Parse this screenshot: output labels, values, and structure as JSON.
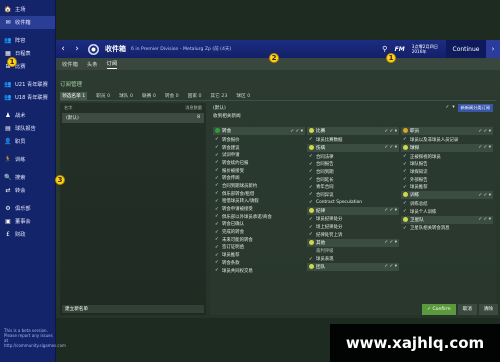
{
  "sidebar": {
    "items": [
      {
        "icon": "🏠",
        "label": "主场"
      },
      {
        "icon": "✉",
        "label": "收件箱"
      },
      {
        "icon": "👥",
        "label": "阵容"
      },
      {
        "icon": "▦",
        "label": "日程表"
      },
      {
        "icon": "⊞",
        "label": "比赛"
      },
      {
        "icon": "👥",
        "label": "U21 青年联赛"
      },
      {
        "icon": "👥",
        "label": "U18 青年联赛"
      },
      {
        "icon": "♟",
        "label": "战术"
      },
      {
        "icon": "▤",
        "label": "球队报告"
      },
      {
        "icon": "👤",
        "label": "职员"
      },
      {
        "icon": "🏃",
        "label": "训练"
      },
      {
        "icon": "🔍",
        "label": "搜索"
      },
      {
        "icon": "⇄",
        "label": "转会"
      },
      {
        "icon": "⚙",
        "label": "俱乐部"
      },
      {
        "icon": "▣",
        "label": "董事会"
      },
      {
        "icon": "£",
        "label": "财政"
      }
    ],
    "footer": "This is a beta version. Please report any issues at http://community.sigames.com"
  },
  "topbar": {
    "back": "‹",
    "forward": "›",
    "title": "收件箱",
    "subtitle": "6 in Premier Division - Metalurg Zp (前 (4天)",
    "search_icon": "⚲",
    "fm_logo": "FM",
    "date_line1": "3点零2月四日",
    "date_line2": "2016年",
    "continue_label": "Continue",
    "continue_arrow": "›"
  },
  "subtabs": [
    "收件箱",
    "头条",
    "订阅"
  ],
  "sub_header": "订阅管理",
  "filter_tabs": [
    "领选名单 1",
    "职员 0",
    "球队 0",
    "联赛 0",
    "转会 0",
    "国家 0",
    "其它 23",
    "球区 0"
  ],
  "left_pane": {
    "col1": "名字",
    "col2": "消息数量",
    "rows": [
      {
        "name": "(默认)",
        "count": "8"
      }
    ],
    "footer": "建立新名单"
  },
  "right_pane": {
    "title": "(默认)",
    "subscriptions_label": "新新闻分类订阅",
    "section_label": "收到相关新闻",
    "columns": [
      [
        {
          "type": "head",
          "label": "转会",
          "dot": "#2f9d3c"
        },
        {
          "label": "转会报价"
        },
        {
          "label": "转会建议"
        },
        {
          "label": "试训申请"
        },
        {
          "label": "转会续约已报"
        },
        {
          "label": "报价被接受"
        },
        {
          "label": "转会传闻"
        },
        {
          "label": "合同到期球员新约"
        },
        {
          "label": "俱乐部转会/租借"
        },
        {
          "label": "租借球员转入/请假"
        },
        {
          "label": "转会申请被接受"
        },
        {
          "label": "俱乐部以外球员承诺/商会"
        },
        {
          "label": "转会已确认"
        },
        {
          "label": "完成的转会"
        },
        {
          "label": "未来可能的转会"
        },
        {
          "label": "签订证明函"
        },
        {
          "label": "球员推荐"
        },
        {
          "label": "转会条款"
        },
        {
          "label": "球员共同权交易"
        }
      ],
      [
        {
          "type": "head",
          "label": "比赛",
          "dot": "#cfd84a"
        },
        {
          "label": "球员比赛数据"
        },
        {
          "type": "head",
          "label": "伤病",
          "dot": "#cfd84a"
        },
        {
          "label": "合同法律"
        },
        {
          "label": "合同报告"
        },
        {
          "label": "合同到期"
        },
        {
          "label": "合同延长"
        },
        {
          "label": "青年合同"
        },
        {
          "label": "合同异议"
        },
        {
          "label": "Contract Speculation"
        },
        {
          "type": "head",
          "label": "纪律",
          "dot": "#cfd84a"
        },
        {
          "label": "球员纪律处分"
        },
        {
          "label": "场上纪律处分"
        },
        {
          "label": "纪律处罚上诉"
        },
        {
          "type": "head",
          "label": "其他",
          "dot": "#cfd84a"
        },
        {
          "label": "裁判评级",
          "dim": true
        },
        {
          "label": "球员表现"
        },
        {
          "type": "head",
          "label": "团队",
          "dot": "#cfd84a"
        }
      ],
      [
        {
          "type": "head",
          "label": "职员",
          "dot": "#e0a220"
        },
        {
          "label": "球员以及非球员人员记录"
        },
        {
          "type": "head",
          "label": "球探",
          "dot": "#cfd84a"
        },
        {
          "label": "正被探视的球员"
        },
        {
          "label": "球队报告"
        },
        {
          "label": "球探知识"
        },
        {
          "label": "外部报告"
        },
        {
          "label": "球员推荐"
        },
        {
          "type": "head",
          "label": "训练",
          "dot": "#cfd84a"
        },
        {
          "label": "训练总结"
        },
        {
          "label": "球员个人训练"
        },
        {
          "type": "head",
          "label": "卫星队",
          "dot": "#cfd84a"
        },
        {
          "label": "卫星队相关转会消息"
        }
      ]
    ]
  },
  "bottom_bar": {
    "confirm": "✓ Confirm",
    "cancel": "取消",
    "clear": "清除"
  },
  "markers": [
    "2",
    "1",
    "1",
    "3"
  ],
  "watermark": "www.xajhlq.com"
}
